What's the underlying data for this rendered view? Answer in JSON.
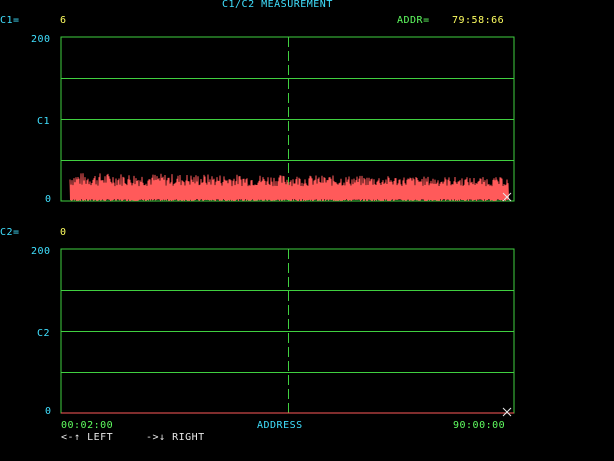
{
  "title": "C1/C2 MEASUREMENT",
  "colors": {
    "background": "#000000",
    "grid": "#40d040",
    "c1_trace": "#ff5a5a",
    "c2_trace": "#ff5a5a",
    "label": "#40e0ff",
    "value": "#ffff60",
    "cursor": "#e8e8e8"
  },
  "header": {
    "c1_label": "C1=",
    "c1_value": "6",
    "addr_label": "ADDR=",
    "addr_value": "79:58:66"
  },
  "panel1": {
    "y_max": "200",
    "y_mid": "C1",
    "y_min": "0"
  },
  "panel2": {
    "readout_label": "C2=",
    "readout_value": "0",
    "y_max": "200",
    "y_mid": "C2",
    "y_min": "0"
  },
  "xaxis": {
    "start": "00:02:00",
    "label": "ADDRESS",
    "end": "90:00:00"
  },
  "footer": {
    "left_hint": "<-↑ LEFT",
    "right_hint": "->↓ RIGHT"
  },
  "chart_data": [
    {
      "type": "line",
      "name": "C1",
      "ylim": [
        0,
        200
      ],
      "baseline": 0,
      "mean": 18,
      "amplitude": 14
    },
    {
      "type": "line",
      "name": "C2",
      "ylim": [
        0,
        200
      ],
      "values": [
        0,
        0
      ]
    }
  ]
}
